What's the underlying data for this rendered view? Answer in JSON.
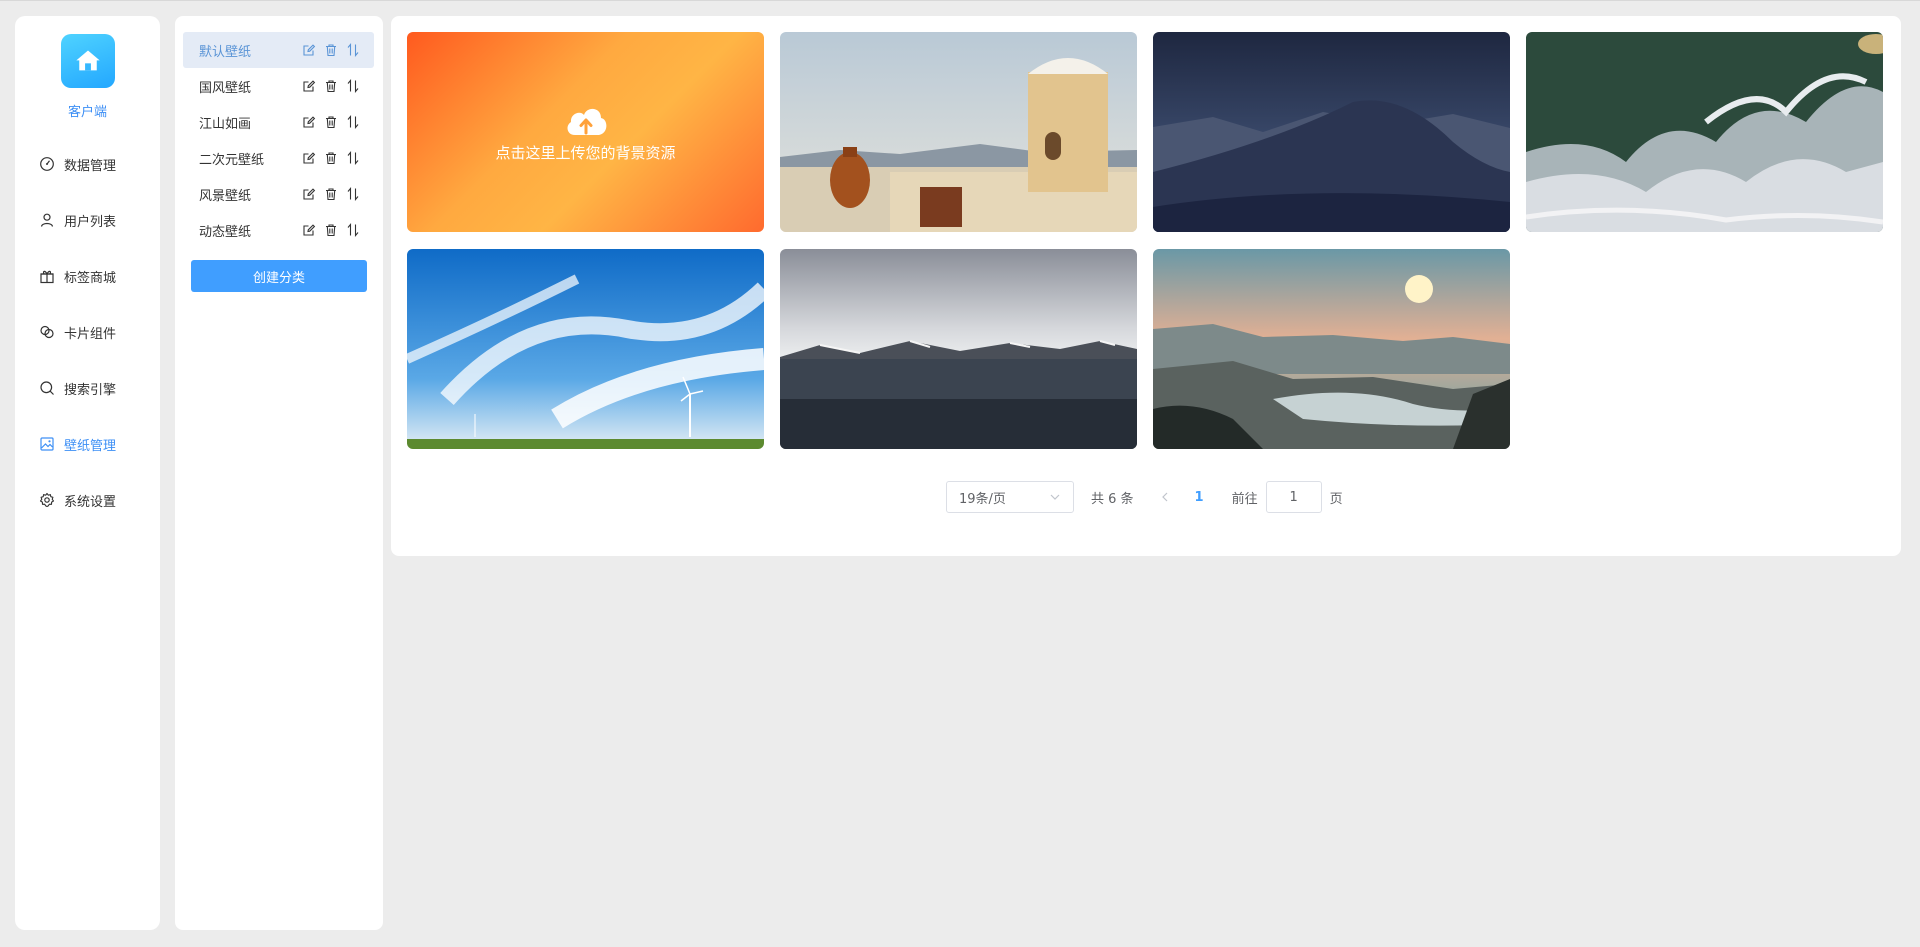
{
  "app": {
    "client_label": "客户端"
  },
  "nav": {
    "items": [
      {
        "label": "数据管理",
        "icon": "dashboard-icon",
        "active": false
      },
      {
        "label": "用户列表",
        "icon": "user-icon",
        "active": false
      },
      {
        "label": "标签商城",
        "icon": "gift-icon",
        "active": false
      },
      {
        "label": "卡片组件",
        "icon": "link-icon",
        "active": false
      },
      {
        "label": "搜索引擎",
        "icon": "search-icon",
        "active": false
      },
      {
        "label": "壁纸管理",
        "icon": "image-icon",
        "active": true
      },
      {
        "label": "系统设置",
        "icon": "gear-icon",
        "active": false
      }
    ]
  },
  "categories": {
    "items": [
      {
        "label": "默认壁纸",
        "active": true
      },
      {
        "label": "国风壁纸",
        "active": false
      },
      {
        "label": "江山如画",
        "active": false
      },
      {
        "label": "二次元壁纸",
        "active": false
      },
      {
        "label": "风景壁纸",
        "active": false
      },
      {
        "label": "动态壁纸",
        "active": false
      }
    ],
    "create_label": "创建分类"
  },
  "gallery": {
    "upload_text": "点击这里上传您的背景资源",
    "wallpapers": [
      "santorini",
      "desert-dunes",
      "ocean-waves",
      "blue-sky-windmills",
      "lake-mountains",
      "canyon-sunset"
    ]
  },
  "pagination": {
    "page_size_label": "19条/页",
    "total_text": "共 6 条",
    "current_page": "1",
    "goto_label": "前往",
    "goto_value": "1",
    "page_unit": "页"
  },
  "colors": {
    "primary": "#409eff",
    "active_text": "#3d8ff5",
    "background": "#ececec"
  }
}
